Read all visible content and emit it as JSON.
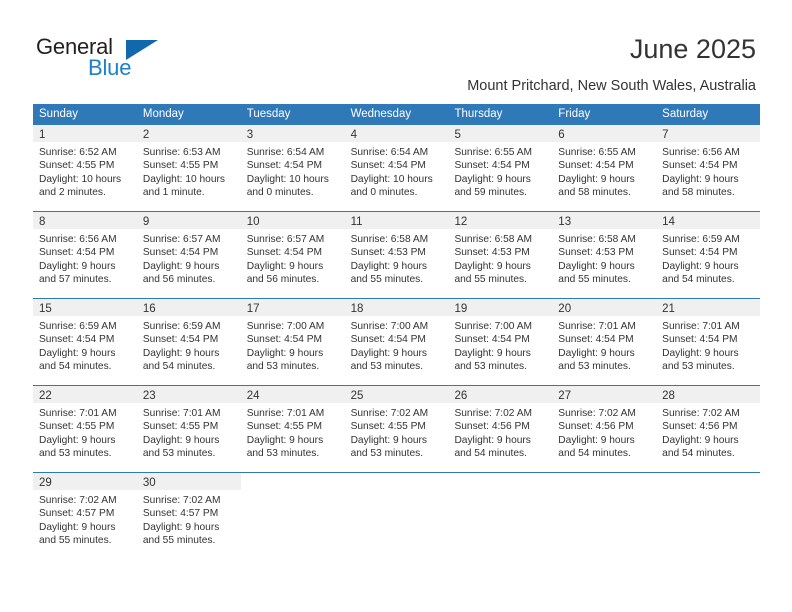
{
  "logo": {
    "primary_text": "General",
    "secondary_text": "Blue",
    "triangle_color": "#1169ab",
    "secondary_color": "#1e80c8"
  },
  "header": {
    "title": "June 2025",
    "subtitle": "Mount Pritchard, New South Wales, Australia"
  },
  "theme": {
    "header_blue": "#3079b8",
    "daynum_band": "#f0f0f0",
    "text": "#333333"
  },
  "calendar": {
    "weekday_headers": [
      "Sunday",
      "Monday",
      "Tuesday",
      "Wednesday",
      "Thursday",
      "Friday",
      "Saturday"
    ],
    "weeks": [
      [
        {
          "day": "1",
          "sunrise": "Sunrise: 6:52 AM",
          "sunset": "Sunset: 4:55 PM",
          "daylight1": "Daylight: 10 hours",
          "daylight2": "and 2 minutes."
        },
        {
          "day": "2",
          "sunrise": "Sunrise: 6:53 AM",
          "sunset": "Sunset: 4:55 PM",
          "daylight1": "Daylight: 10 hours",
          "daylight2": "and 1 minute."
        },
        {
          "day": "3",
          "sunrise": "Sunrise: 6:54 AM",
          "sunset": "Sunset: 4:54 PM",
          "daylight1": "Daylight: 10 hours",
          "daylight2": "and 0 minutes."
        },
        {
          "day": "4",
          "sunrise": "Sunrise: 6:54 AM",
          "sunset": "Sunset: 4:54 PM",
          "daylight1": "Daylight: 10 hours",
          "daylight2": "and 0 minutes."
        },
        {
          "day": "5",
          "sunrise": "Sunrise: 6:55 AM",
          "sunset": "Sunset: 4:54 PM",
          "daylight1": "Daylight: 9 hours",
          "daylight2": "and 59 minutes."
        },
        {
          "day": "6",
          "sunrise": "Sunrise: 6:55 AM",
          "sunset": "Sunset: 4:54 PM",
          "daylight1": "Daylight: 9 hours",
          "daylight2": "and 58 minutes."
        },
        {
          "day": "7",
          "sunrise": "Sunrise: 6:56 AM",
          "sunset": "Sunset: 4:54 PM",
          "daylight1": "Daylight: 9 hours",
          "daylight2": "and 58 minutes."
        }
      ],
      [
        {
          "day": "8",
          "sunrise": "Sunrise: 6:56 AM",
          "sunset": "Sunset: 4:54 PM",
          "daylight1": "Daylight: 9 hours",
          "daylight2": "and 57 minutes."
        },
        {
          "day": "9",
          "sunrise": "Sunrise: 6:57 AM",
          "sunset": "Sunset: 4:54 PM",
          "daylight1": "Daylight: 9 hours",
          "daylight2": "and 56 minutes."
        },
        {
          "day": "10",
          "sunrise": "Sunrise: 6:57 AM",
          "sunset": "Sunset: 4:54 PM",
          "daylight1": "Daylight: 9 hours",
          "daylight2": "and 56 minutes."
        },
        {
          "day": "11",
          "sunrise": "Sunrise: 6:58 AM",
          "sunset": "Sunset: 4:53 PM",
          "daylight1": "Daylight: 9 hours",
          "daylight2": "and 55 minutes."
        },
        {
          "day": "12",
          "sunrise": "Sunrise: 6:58 AM",
          "sunset": "Sunset: 4:53 PM",
          "daylight1": "Daylight: 9 hours",
          "daylight2": "and 55 minutes."
        },
        {
          "day": "13",
          "sunrise": "Sunrise: 6:58 AM",
          "sunset": "Sunset: 4:53 PM",
          "daylight1": "Daylight: 9 hours",
          "daylight2": "and 55 minutes."
        },
        {
          "day": "14",
          "sunrise": "Sunrise: 6:59 AM",
          "sunset": "Sunset: 4:54 PM",
          "daylight1": "Daylight: 9 hours",
          "daylight2": "and 54 minutes."
        }
      ],
      [
        {
          "day": "15",
          "sunrise": "Sunrise: 6:59 AM",
          "sunset": "Sunset: 4:54 PM",
          "daylight1": "Daylight: 9 hours",
          "daylight2": "and 54 minutes."
        },
        {
          "day": "16",
          "sunrise": "Sunrise: 6:59 AM",
          "sunset": "Sunset: 4:54 PM",
          "daylight1": "Daylight: 9 hours",
          "daylight2": "and 54 minutes."
        },
        {
          "day": "17",
          "sunrise": "Sunrise: 7:00 AM",
          "sunset": "Sunset: 4:54 PM",
          "daylight1": "Daylight: 9 hours",
          "daylight2": "and 53 minutes."
        },
        {
          "day": "18",
          "sunrise": "Sunrise: 7:00 AM",
          "sunset": "Sunset: 4:54 PM",
          "daylight1": "Daylight: 9 hours",
          "daylight2": "and 53 minutes."
        },
        {
          "day": "19",
          "sunrise": "Sunrise: 7:00 AM",
          "sunset": "Sunset: 4:54 PM",
          "daylight1": "Daylight: 9 hours",
          "daylight2": "and 53 minutes."
        },
        {
          "day": "20",
          "sunrise": "Sunrise: 7:01 AM",
          "sunset": "Sunset: 4:54 PM",
          "daylight1": "Daylight: 9 hours",
          "daylight2": "and 53 minutes."
        },
        {
          "day": "21",
          "sunrise": "Sunrise: 7:01 AM",
          "sunset": "Sunset: 4:54 PM",
          "daylight1": "Daylight: 9 hours",
          "daylight2": "and 53 minutes."
        }
      ],
      [
        {
          "day": "22",
          "sunrise": "Sunrise: 7:01 AM",
          "sunset": "Sunset: 4:55 PM",
          "daylight1": "Daylight: 9 hours",
          "daylight2": "and 53 minutes."
        },
        {
          "day": "23",
          "sunrise": "Sunrise: 7:01 AM",
          "sunset": "Sunset: 4:55 PM",
          "daylight1": "Daylight: 9 hours",
          "daylight2": "and 53 minutes."
        },
        {
          "day": "24",
          "sunrise": "Sunrise: 7:01 AM",
          "sunset": "Sunset: 4:55 PM",
          "daylight1": "Daylight: 9 hours",
          "daylight2": "and 53 minutes."
        },
        {
          "day": "25",
          "sunrise": "Sunrise: 7:02 AM",
          "sunset": "Sunset: 4:55 PM",
          "daylight1": "Daylight: 9 hours",
          "daylight2": "and 53 minutes."
        },
        {
          "day": "26",
          "sunrise": "Sunrise: 7:02 AM",
          "sunset": "Sunset: 4:56 PM",
          "daylight1": "Daylight: 9 hours",
          "daylight2": "and 54 minutes."
        },
        {
          "day": "27",
          "sunrise": "Sunrise: 7:02 AM",
          "sunset": "Sunset: 4:56 PM",
          "daylight1": "Daylight: 9 hours",
          "daylight2": "and 54 minutes."
        },
        {
          "day": "28",
          "sunrise": "Sunrise: 7:02 AM",
          "sunset": "Sunset: 4:56 PM",
          "daylight1": "Daylight: 9 hours",
          "daylight2": "and 54 minutes."
        }
      ],
      [
        {
          "day": "29",
          "sunrise": "Sunrise: 7:02 AM",
          "sunset": "Sunset: 4:57 PM",
          "daylight1": "Daylight: 9 hours",
          "daylight2": "and 55 minutes."
        },
        {
          "day": "30",
          "sunrise": "Sunrise: 7:02 AM",
          "sunset": "Sunset: 4:57 PM",
          "daylight1": "Daylight: 9 hours",
          "daylight2": "and 55 minutes."
        },
        {
          "day": "",
          "sunrise": "",
          "sunset": "",
          "daylight1": "",
          "daylight2": ""
        },
        {
          "day": "",
          "sunrise": "",
          "sunset": "",
          "daylight1": "",
          "daylight2": ""
        },
        {
          "day": "",
          "sunrise": "",
          "sunset": "",
          "daylight1": "",
          "daylight2": ""
        },
        {
          "day": "",
          "sunrise": "",
          "sunset": "",
          "daylight1": "",
          "daylight2": ""
        },
        {
          "day": "",
          "sunrise": "",
          "sunset": "",
          "daylight1": "",
          "daylight2": ""
        }
      ]
    ]
  }
}
